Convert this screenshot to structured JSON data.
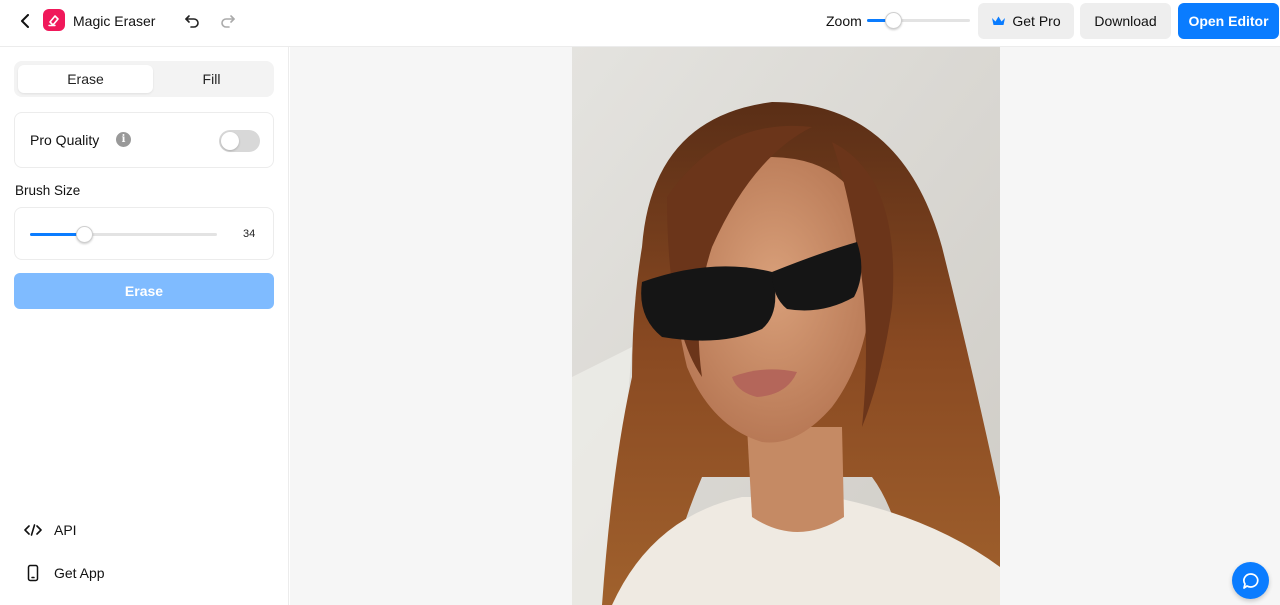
{
  "header": {
    "app_title": "Magic Eraser",
    "zoom_label": "Zoom",
    "zoom_level": 0.25,
    "get_pro_label": "Get Pro",
    "download_label": "Download",
    "open_editor_label": "Open Editor",
    "icons": [
      "back-icon",
      "magic-eraser-logo-icon",
      "undo-icon",
      "redo-icon",
      "crown-icon"
    ]
  },
  "sidebar": {
    "tabs": [
      {
        "label": "Erase",
        "active": true
      },
      {
        "label": "Fill",
        "active": false
      }
    ],
    "pro_quality": {
      "label": "Pro Quality",
      "info_icon": "info-icon",
      "enabled": false
    },
    "brush_size": {
      "label": "Brush Size",
      "value": "34",
      "fraction": 0.29
    },
    "erase_button_label": "Erase",
    "links": [
      {
        "label": "API",
        "icon": "code-icon"
      },
      {
        "label": "Get App",
        "icon": "phone-icon"
      }
    ]
  },
  "canvas": {
    "image_alt": "Portrait photo of a woman with long auburn hair wearing black sunglasses and a white t-shirt"
  },
  "chat": {
    "icon": "chat-bubble-icon"
  },
  "colors": {
    "accent": "#0a7cff",
    "accent_disabled": "#7fbbff",
    "logo": "#f0185a"
  }
}
